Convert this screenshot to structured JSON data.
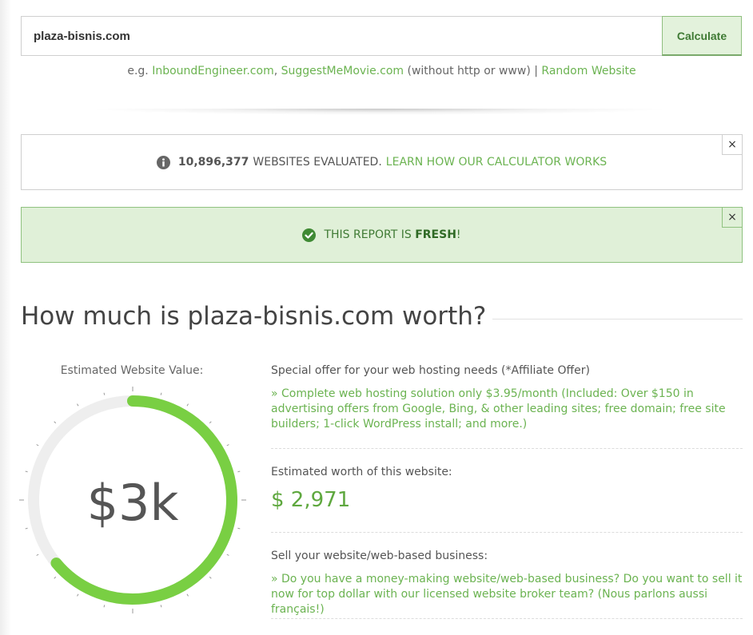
{
  "search": {
    "value": "plaza-bisnis.com",
    "button_label": "Calculate"
  },
  "examples": {
    "prefix": "e.g.",
    "example1": "InboundEngineer.com",
    "comma": ",",
    "example2": "SuggestMeMovie.com",
    "note": "(without http or www) |",
    "random": "Random Website"
  },
  "info_notice": {
    "count": "10,896,377",
    "text": "WEBSITES EVALUATED.",
    "link": "LEARN HOW OUR CALCULATOR WORKS",
    "close": "×"
  },
  "fresh_notice": {
    "prefix": "THIS REPORT IS",
    "highlight": "FRESH",
    "suffix": "!",
    "close": "×"
  },
  "heading": "How much is plaza-bisnis.com worth?",
  "gauge": {
    "label": "Estimated Website Value:",
    "display_value": "$3k",
    "fill_fraction": 0.64,
    "colors": {
      "track": "#eeeeee",
      "fill": "#79cf43",
      "ticks": "#999999"
    }
  },
  "hosting_offer": {
    "title": "Special offer for your web hosting needs (*Affiliate Offer)",
    "link": "» Complete web hosting solution only $3.95/month (Included: Over $150 in advertising offers from Google, Bing, & other leading sites; free domain; free site builders; 1-click WordPress install; and more.)"
  },
  "worth": {
    "title": "Estimated worth of this website:",
    "value": "$ 2,971"
  },
  "sell": {
    "title": "Sell your website/web-based business:",
    "link": "» Do you have a money-making website/web-based business? Do you want to sell it now for top dollar with our licensed website broker team? (Nous parlons aussi français!)"
  },
  "colors": {
    "accent": "#6bb351",
    "success_bg": "#e0f0d8",
    "success_text": "#3f7a34"
  }
}
